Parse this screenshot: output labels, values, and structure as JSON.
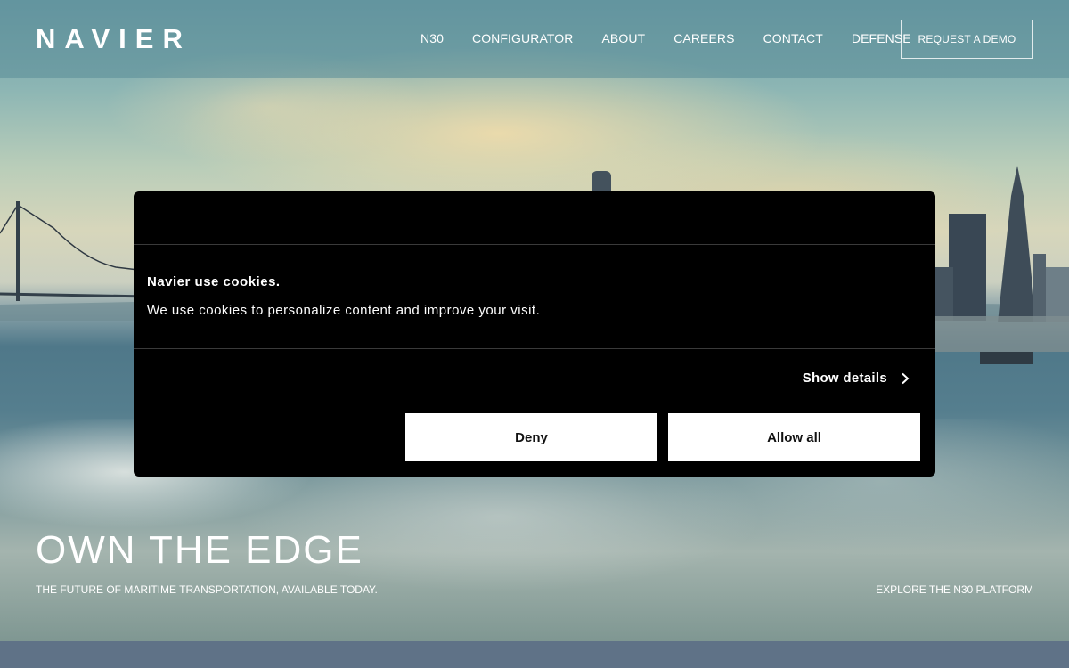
{
  "header": {
    "logo_text": "NAVIER",
    "nav": [
      {
        "label": "N30"
      },
      {
        "label": "CONFIGURATOR"
      },
      {
        "label": "ABOUT"
      },
      {
        "label": "CAREERS"
      },
      {
        "label": "CONTACT"
      },
      {
        "label": "DEFENSE"
      }
    ],
    "demo_button": "REQUEST A DEMO"
  },
  "hero": {
    "title": "OWN THE EDGE",
    "subtitle": "THE FUTURE OF MARITIME TRANSPORTATION, AVAILABLE TODAY.",
    "explore_link": "EXPLORE THE N30 PLATFORM"
  },
  "cookie_dialog": {
    "heading": "Navier use cookies.",
    "text": "We use cookies to personalize content and improve your visit.",
    "show_details": "Show details",
    "deny": "Deny",
    "allow_all": "Allow all"
  },
  "colors": {
    "dialog_bg": "#000000",
    "button_bg": "#ffffff",
    "header_overlay": "#5a8c98",
    "bottom_band": "#5f7287"
  },
  "icons": {
    "show_details_chevron": "chevron-right-icon"
  }
}
